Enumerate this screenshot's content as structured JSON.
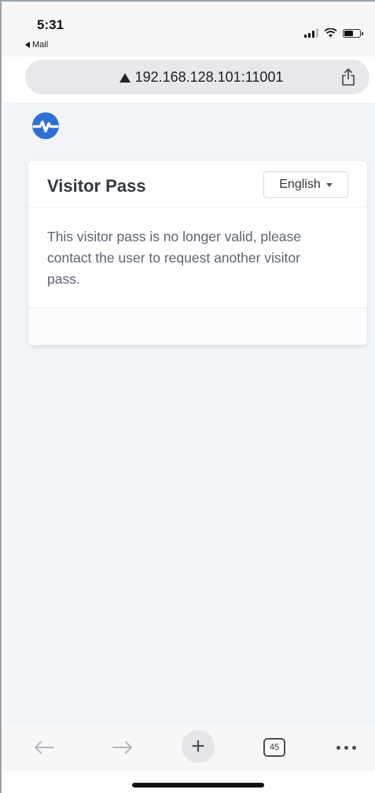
{
  "status_bar": {
    "time": "5:31",
    "back_app": "Mail"
  },
  "browser": {
    "url": "192.168.128.101:11001",
    "tabs_count": "45",
    "new_tab_glyph": "+"
  },
  "icons": {
    "logo": "heartbeat-circle-logo",
    "url_warning": "warning-triangle-icon",
    "share": "share-icon",
    "back": "arrow-left-icon",
    "forward": "arrow-right-icon",
    "more": "ellipsis-icon"
  },
  "card": {
    "title": "Visitor Pass",
    "language": "English",
    "message": "This visitor pass is no longer valid, please contact the user to request another visitor pass."
  },
  "colors": {
    "logo_blue": "#2f6fd3",
    "page_background": "#f1f4f8",
    "card_background": "#ffffff"
  }
}
